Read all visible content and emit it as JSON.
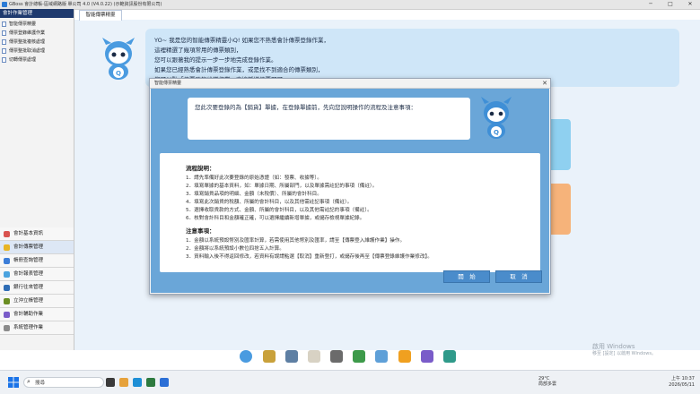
{
  "window": {
    "title": "GBoss 會計總帳-區域網路版 單公司 4.0 (V4.0.22) (示範資訊股份有限公司)",
    "min": "─",
    "max": "□",
    "close": "✕"
  },
  "sidebar": {
    "header": "會計作業管理",
    "tree": [
      "智能傳票精靈",
      "傳票登錄維護作業",
      "傳票整批複核處理",
      "傳票整批取消處理",
      "切轉傳票處理"
    ],
    "menu": [
      {
        "label": "會計基本資訊",
        "color": "#d9534f"
      },
      {
        "label": "會計傳票管理",
        "color": "#e8b423"
      },
      {
        "label": "帳冊查詢管理",
        "color": "#3b7dd8"
      },
      {
        "label": "會計報表管理",
        "color": "#4aa3df"
      },
      {
        "label": "銀行往來管理",
        "color": "#2f6db5"
      },
      {
        "label": "立沖立帳管理",
        "color": "#6b8e23"
      },
      {
        "label": "會計輔助作業",
        "color": "#7a5cc9"
      },
      {
        "label": "系統管理作業",
        "color": "#8c8c8c"
      }
    ]
  },
  "tab": {
    "label": "智能傳票精靈"
  },
  "banner": {
    "lines": "YO~ 我是您的智能傳票精靈小Q! 如果您不熟悉會計傳票登錄作業，\n這裡精選了幾項常用的傳票類別，\n您可以跟著我的提示一步一步地完成登錄作業。\n如果您已經熟悉會計傳票登錄作業，或是找不到適合的傳票類別，\n您可以點「傳票登錄維護作業」直接新增傳票即可。"
  },
  "dialog": {
    "title": "智能傳票精靈",
    "close": "✕",
    "speech": "您此次要登錄的為【銷貨】單據，在登錄單據前，先向您說明操作的流程及注意事項：",
    "process_title": "流程說明：",
    "process": [
      "1．請先準備好此次要登錄的原始憑證（如：發票、收據等）。",
      "2．填寫單據的基本資料，如：單據日期、所屬部門，以及單據需註記的事項（備註）。",
      "3．填寫銷貨品項的明細、金額（未稅價）、所屬的會計科目。",
      "4．填寫此次銷貨的稅額、所屬的會計科目，以及其他需註記事項（備註）。",
      "5．選擇收取貨款的方式、金額、所屬的會計科目，以及其他需註記的事項（備註）。",
      "6．核對會計科目和金額確正確，可以選擇繼續新增單據，或儲存檢視單據紀錄。"
    ],
    "notes_title": "注意事項：",
    "notes": [
      "1．金額以系統預設幣別及匯率計算，若需使用其他幣別及匯率，請至【傳票登入維護作業】操作。",
      "2．金額將以系統預設小數位四捨五入計算。",
      "3．資料輸入後不得返回修改，若資料有誤請點選【取消】重新登打，或儲存後再至【傳票登錄維護作業修改】。"
    ],
    "start_button": "開　始",
    "cancel_button": "取　消"
  },
  "watermark": {
    "line1": "啟用 Windows",
    "line2": "移至 [設定] 以啟用 Windows。"
  },
  "dock_icons": [
    "mascot-icon",
    "scale-icon",
    "checkbook-icon",
    "document-icon",
    "bank-icon",
    "recycle-icon",
    "folder-icon",
    "alert-icon",
    "q-app-icon",
    "book-icon"
  ],
  "taskbar": {
    "search_placeholder": "搜尋",
    "weather_temp": "29°C",
    "weather_desc": "局部多雲",
    "time": "10:37",
    "date": "2026/05/11",
    "ime": "上午"
  }
}
